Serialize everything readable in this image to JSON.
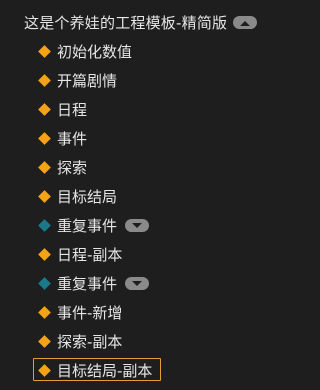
{
  "tree": {
    "root": {
      "label": "这是个养娃的工程模板-精简版",
      "toggle_icon": "chevron-up-icon",
      "toggle_color": "#8a8a8a"
    },
    "items": [
      {
        "label": "初始化数值",
        "marker": "diamond-orange-icon"
      },
      {
        "label": "开篇剧情",
        "marker": "diamond-orange-icon"
      },
      {
        "label": "日程",
        "marker": "diamond-orange-icon"
      },
      {
        "label": "事件",
        "marker": "diamond-orange-icon"
      },
      {
        "label": "探索",
        "marker": "diamond-orange-icon"
      },
      {
        "label": "目标结局",
        "marker": "diamond-orange-icon"
      },
      {
        "label": "重复事件",
        "marker": "diamond-teal-icon",
        "toggle_icon": "chevron-down-icon"
      },
      {
        "label": "日程-副本",
        "marker": "diamond-orange-icon"
      },
      {
        "label": "重复事件",
        "marker": "diamond-teal-icon",
        "toggle_icon": "chevron-down-icon"
      },
      {
        "label": "事件-新增",
        "marker": "diamond-orange-icon"
      },
      {
        "label": "探索-副本",
        "marker": "diamond-orange-icon"
      },
      {
        "label": "目标结局-副本",
        "marker": "diamond-orange-icon",
        "selected": true
      }
    ]
  },
  "colors": {
    "background": "#1e1e1e",
    "text": "#e6e6e6",
    "orange_marker": "#f5a316",
    "teal_marker": "#1a7a8a",
    "selection_border": "#e0a030"
  }
}
